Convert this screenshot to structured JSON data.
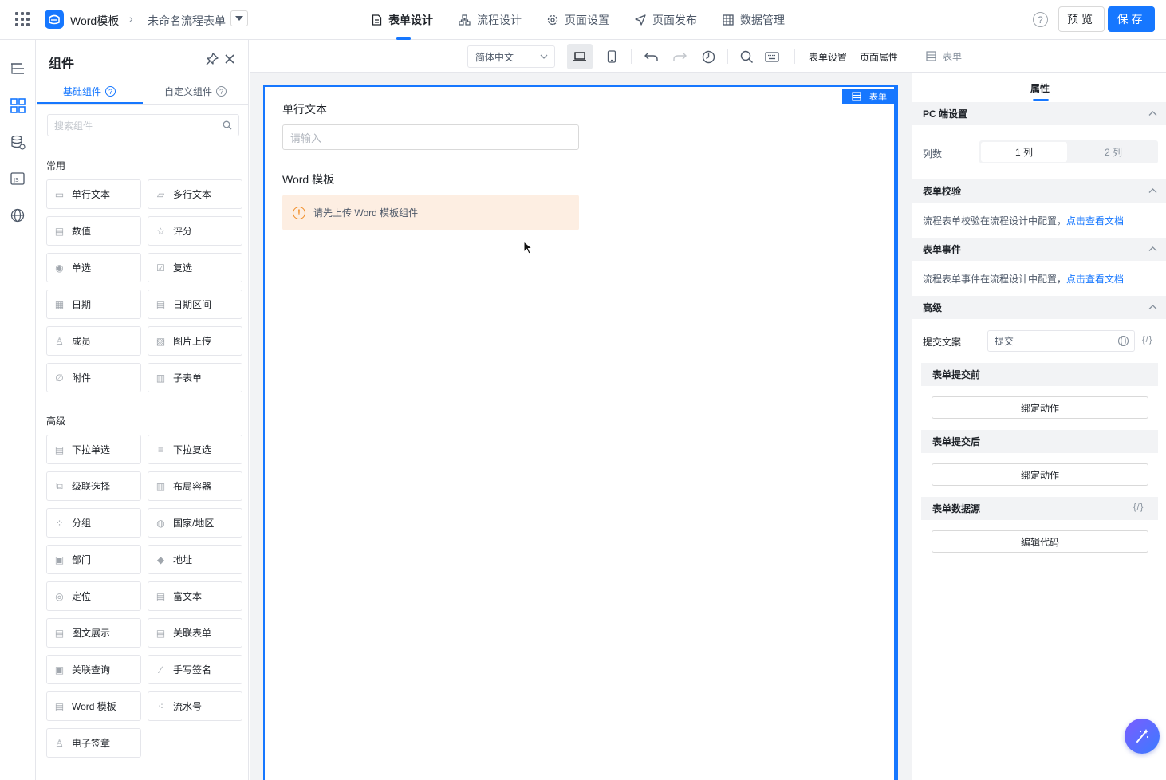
{
  "topbar": {
    "app_name": "Word模板",
    "form_name": "未命名流程表单",
    "tabs": [
      {
        "label": "表单设计",
        "icon": "document-icon",
        "active": true
      },
      {
        "label": "流程设计",
        "icon": "flow-icon",
        "active": false
      },
      {
        "label": "页面设置",
        "icon": "gear-icon",
        "active": false
      },
      {
        "label": "页面发布",
        "icon": "send-icon",
        "active": false
      },
      {
        "label": "数据管理",
        "icon": "table-icon",
        "active": false
      }
    ],
    "help": "?",
    "preview_label": "预览",
    "save_label": "保存"
  },
  "components_panel": {
    "title": "组件",
    "tab_basic": "基础组件",
    "tab_custom": "自定义组件",
    "search_placeholder": "搜索组件",
    "group_common": "常用",
    "common_items": [
      "单行文本",
      "多行文本",
      "数值",
      "评分",
      "单选",
      "复选",
      "日期",
      "日期区间",
      "成员",
      "图片上传",
      "附件",
      "子表单"
    ],
    "group_advanced": "高级",
    "advanced_items": [
      "下拉单选",
      "下拉复选",
      "级联选择",
      "布局容器",
      "分组",
      "国家/地区",
      "部门",
      "地址",
      "定位",
      "富文本",
      "图文展示",
      "关联表单",
      "关联查询",
      "手写签名",
      "Word 模板",
      "流水号",
      "电子签章"
    ]
  },
  "toolbar": {
    "language": "简体中文",
    "form_settings": "表单设置",
    "page_properties": "页面属性"
  },
  "canvas": {
    "tag_label": "表单",
    "field1_label": "单行文本",
    "field1_placeholder": "请输入",
    "field2_label": "Word 模板",
    "field2_warning": "请先上传 Word 模板组件"
  },
  "right_panel": {
    "header": "表单",
    "tab": "属性",
    "pc_settings": "PC 端设置",
    "columns_label": "列数",
    "col1": "1 列",
    "col2": "2 列",
    "validation_title": "表单校验",
    "validation_desc": "流程表单校验在流程设计中配置，",
    "validation_link": "点击查看文档",
    "events_title": "表单事件",
    "events_desc": "流程表单事件在流程设计中配置，",
    "events_link": "点击查看文档",
    "advanced_title": "高级",
    "submit_text_label": "提交文案",
    "submit_text_value": "提交",
    "code_mark": "{/}",
    "before_submit": "表单提交前",
    "bind_action_1": "绑定动作",
    "after_submit": "表单提交后",
    "bind_action_2": "绑定动作",
    "datasource": "表单数据源",
    "edit_code": "编辑代码"
  },
  "colors": {
    "accent": "#1677ff",
    "warning_bg": "#fdeee2",
    "warning_icon": "#f08c25"
  }
}
